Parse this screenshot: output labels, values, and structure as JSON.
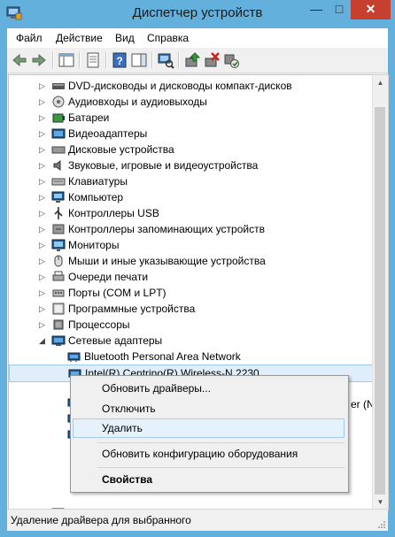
{
  "window": {
    "title": "Диспетчер устройств",
    "min": "—",
    "max": "□",
    "close": "✕"
  },
  "menu": [
    "Файл",
    "Действие",
    "Вид",
    "Справка"
  ],
  "tree": [
    {
      "label": "DVD-дисководы и дисководы компакт-дисков",
      "icon": "dvd-drive-icon"
    },
    {
      "label": "Аудиовходы и аудиовыходы",
      "icon": "audio-io-icon"
    },
    {
      "label": "Батареи",
      "icon": "battery-icon"
    },
    {
      "label": "Видеоадаптеры",
      "icon": "display-adapter-icon"
    },
    {
      "label": "Дисковые устройства",
      "icon": "disk-drive-icon"
    },
    {
      "label": "Звуковые, игровые и видеоустройства",
      "icon": "speaker-icon"
    },
    {
      "label": "Клавиатуры",
      "icon": "keyboard-icon"
    },
    {
      "label": "Компьютер",
      "icon": "computer-icon"
    },
    {
      "label": "Контроллеры USB",
      "icon": "usb-icon"
    },
    {
      "label": "Контроллеры запоминающих устройств",
      "icon": "storage-controller-icon"
    },
    {
      "label": "Мониторы",
      "icon": "monitor-icon"
    },
    {
      "label": "Мыши и иные указывающие устройства",
      "icon": "mouse-icon"
    },
    {
      "label": "Очереди печати",
      "icon": "printer-icon"
    },
    {
      "label": "Порты (COM и LPT)",
      "icon": "port-icon"
    },
    {
      "label": "Программные устройства",
      "icon": "software-device-icon"
    },
    {
      "label": "Процессоры",
      "icon": "processor-icon"
    },
    {
      "label": "Сетевые адаптеры",
      "icon": "network-adapter-icon"
    }
  ],
  "network_children": [
    {
      "label": "Bluetooth Personal Area Network",
      "icon": "network-card-icon"
    },
    {
      "label": "Intel(R) Centrino(R) Wireless-N 2230",
      "icon": "network-card-icon"
    }
  ],
  "obscured_fragment": "er (N",
  "context_menu": {
    "update": "Обновить драйверы...",
    "disable": "Отключить",
    "uninstall": "Удалить",
    "scan": "Обновить конфигурацию оборудования",
    "properties": "Свойства"
  },
  "status": "Удаление драйвера для выбранного",
  "colors": {
    "titlebar": "#63b0dc",
    "close": "#c7402f",
    "highlight": "#e5f1fb"
  }
}
